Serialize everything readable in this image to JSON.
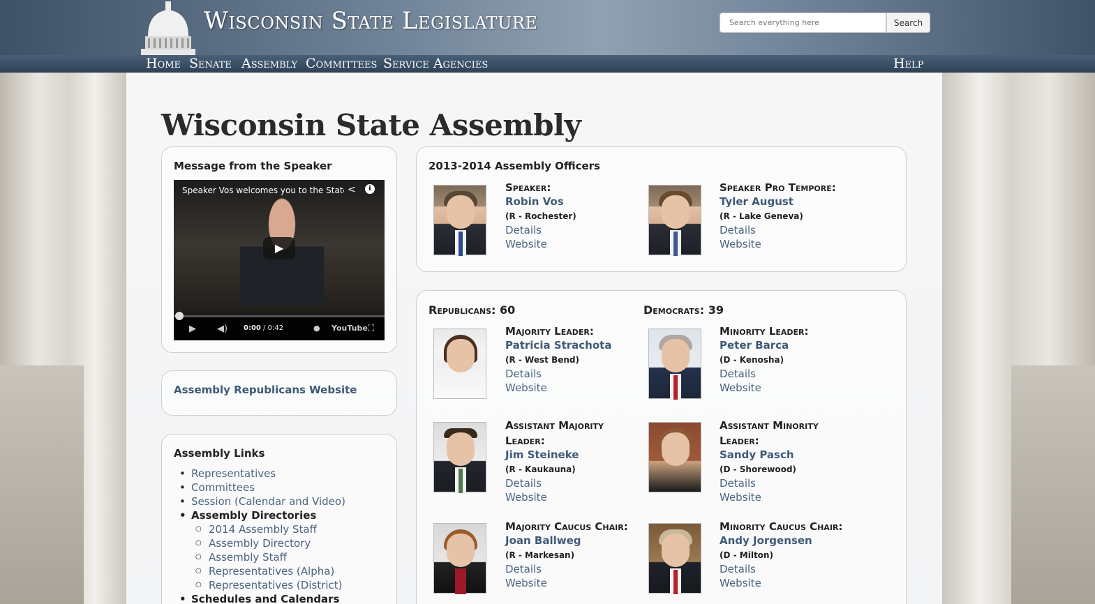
{
  "header": {
    "site_title": "Wisconsin State Legislature",
    "search_placeholder": "Search everything here",
    "search_button": "Search",
    "nav": [
      "Home",
      "Senate",
      "Assembly",
      "Committees",
      "Service Agencies"
    ],
    "help": "Help"
  },
  "page": {
    "title": "Wisconsin State Assembly"
  },
  "speaker_message": {
    "title": "Message from the Speaker",
    "video_caption": "Speaker Vos welcomes you to the State",
    "video_time_current": "0:00",
    "video_time_total": " / 0:42",
    "youtube_label": "YouTube"
  },
  "republicans_site": {
    "label": "Assembly Republicans Website"
  },
  "assembly_links": {
    "title": "Assembly Links",
    "items": [
      {
        "label": "Representatives"
      },
      {
        "label": "Committees"
      },
      {
        "label": "Session (Calendar and Video)"
      },
      {
        "label": "Assembly Directories"
      },
      {
        "label": "2014 Assembly Staff"
      },
      {
        "label": "Assembly Directory"
      },
      {
        "label": "Assembly Staff"
      },
      {
        "label": "Representatives (Alpha)"
      },
      {
        "label": "Representatives (District)"
      },
      {
        "label": "Schedules and Calendars"
      }
    ]
  },
  "officers": {
    "title": "2013-2014 Assembly Officers",
    "speaker": {
      "role": "Speaker:",
      "name": "Robin Vos",
      "district": "(R - Rochester)",
      "details": "Details",
      "website": "Website"
    },
    "speaker_pro_tempore": {
      "role": "Speaker Pro Tempore:",
      "name": "Tyler August",
      "district": "(R - Lake Geneva)",
      "details": "Details",
      "website": "Website"
    }
  },
  "leadership": {
    "republicans_label": "Republicans: 60",
    "democrats_label": "Democrats: 39",
    "majority_leader": {
      "role": "Majority Leader:",
      "name": "Patricia Strachota",
      "district": "(R - West Bend)",
      "details": "Details",
      "website": "Website"
    },
    "minority_leader": {
      "role": "Minority Leader:",
      "name": "Peter Barca",
      "district": "(D - Kenosha)",
      "details": "Details",
      "website": "Website"
    },
    "asst_majority_leader": {
      "role_line1": "Assistant Majority",
      "role_line2": "Leader:",
      "name": "Jim Steineke",
      "district": "(R - Kaukauna)",
      "details": "Details",
      "website": "Website"
    },
    "asst_minority_leader": {
      "role_line1": "Assistant Minority",
      "role_line2": "Leader:",
      "name": "Sandy Pasch",
      "district": "(D - Shorewood)",
      "details": "Details",
      "website": "Website"
    },
    "majority_caucus_chair": {
      "role": "Majority Caucus Chair:",
      "name": "Joan Ballweg",
      "district": "(R - Markesan)",
      "details": "Details",
      "website": "Website"
    },
    "minority_caucus_chair": {
      "role": "Minority Caucus Chair:",
      "name": "Andy Jorgensen",
      "district": "(D - Milton)",
      "details": "Details",
      "website": "Website"
    }
  }
}
